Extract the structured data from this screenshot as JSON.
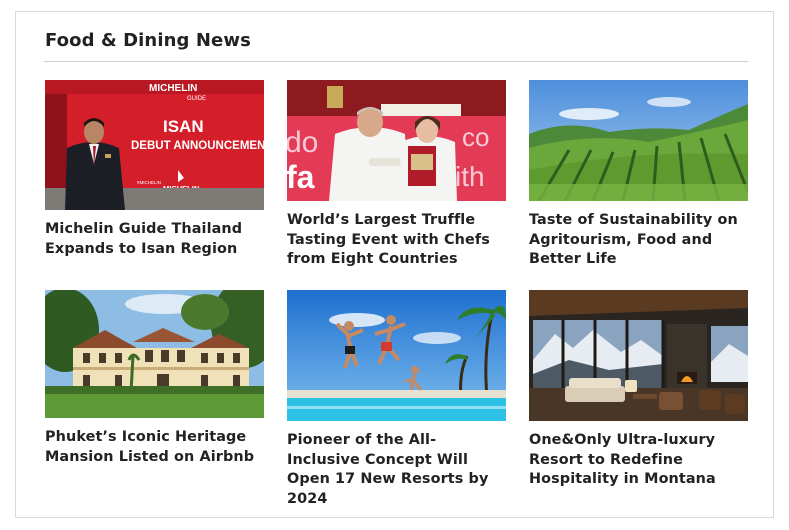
{
  "section": {
    "title": "Food & Dining News"
  },
  "articles": [
    {
      "title": "Michelin Guide Thailand Expands to Isan Region",
      "image": {
        "alt": "michelin-isan-announcement-image",
        "sign_lines": [
          "ISAN",
          "DEBUT ANNOUNCEMENT"
        ],
        "brand": "MICHELIN",
        "brand_top": "MICHELIN",
        "brand_sub": "GUIDE",
        "hashtag": "#MICHELINGUIDETH"
      }
    },
    {
      "title": "World’s Largest Truffle Tasting Event with Chefs from Eight Countries",
      "image": {
        "alt": "truffle-chefs-image",
        "banner_left": [
          "do",
          "fa"
        ],
        "banner_right": [
          "co",
          "ith"
        ]
      }
    },
    {
      "title": "Taste of Sustainability on Agritourism, Food and Better Life",
      "image": {
        "alt": "vineyard-hills-image"
      }
    },
    {
      "title": "Phuket’s Iconic Heritage Mansion Listed on Airbnb",
      "image": {
        "alt": "heritage-mansion-image"
      }
    },
    {
      "title": "Pioneer of the All-Inclusive Concept Will Open 17 New Resorts by 2024",
      "image": {
        "alt": "pool-jumping-image"
      }
    },
    {
      "title": "One&Only Ultra-luxury Resort to Redefine Hospitality in Montana",
      "image": {
        "alt": "mountain-resort-lounge-image"
      }
    }
  ],
  "colors": {
    "michelin_red": "#d41f2b",
    "heading": "#222222",
    "rule": "#cfcfcf"
  }
}
